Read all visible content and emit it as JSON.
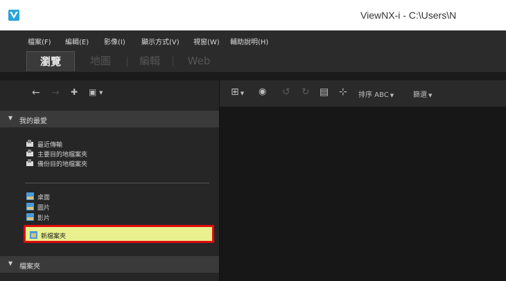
{
  "window": {
    "title": "ViewNX-i - C:\\Users\\N"
  },
  "menu": [
    "檔案(F)",
    "編輯(E)",
    "影像(I)",
    "顯示方式(V)",
    "視窗(W)",
    "輔助說明(H)"
  ],
  "tabs": [
    "瀏覽",
    "地圖",
    "編輯",
    "Web"
  ],
  "nav": {
    "back": "←",
    "forward": "→",
    "favorite": "✚",
    "view": "▣"
  },
  "toolbar": {
    "grid": "⊞",
    "viewer": "◉",
    "rotate_left": "↺",
    "rotate_right": "↻",
    "compare": "▤",
    "sort_icon": "⊹",
    "sort_label": "排序 ABC",
    "filter_label": "篩選"
  },
  "favorites": {
    "title": "我的最愛",
    "group1": [
      "最近傳輸",
      "主要目的地檔案夾",
      "備份目的地檔案夾"
    ],
    "group2": [
      "桌面",
      "圖片",
      "影片"
    ],
    "highlighted": "新檔案夾"
  },
  "folders": {
    "title": "檔案夾"
  },
  "colors": {
    "accent": "#e00b0b",
    "highlight_bg": "#e9f08d"
  }
}
